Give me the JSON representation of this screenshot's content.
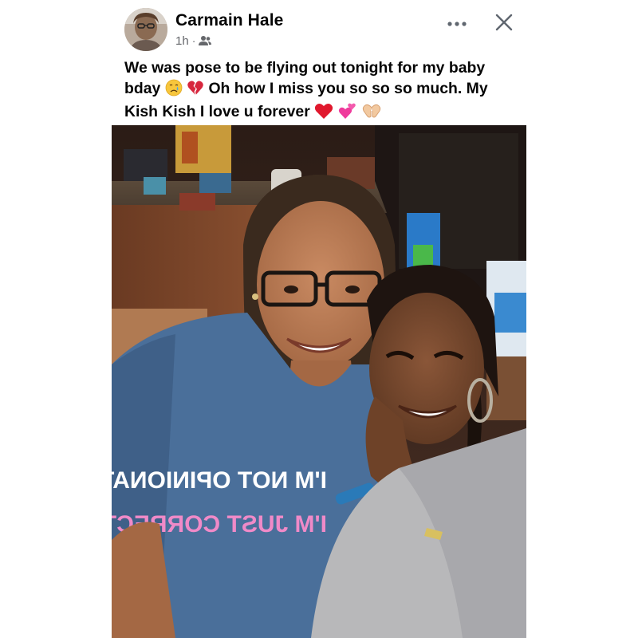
{
  "post": {
    "author": "Carmain Hale",
    "time": "1h",
    "separator": "·",
    "audience_icon": "friends-icon",
    "caption": {
      "part1": "We was pose to be flying out tonight for my baby bday",
      "part2": "Oh how I miss you so so so much. My Kish Kish I love u forever"
    },
    "photo": {
      "shirt_line1": "I'M NOT OPINIONATED..",
      "shirt_line2": "I'M JUST CORRECT."
    }
  },
  "icons": {
    "more": "more-horizontal-icon",
    "close": "close-icon",
    "emojis": [
      "crying-face-emoji",
      "broken-heart-emoji",
      "red-heart-emoji",
      "two-hearts-emoji",
      "heart-hands-emoji"
    ]
  },
  "colors": {
    "text_primary": "#050505",
    "text_secondary": "#65676b",
    "background": "#ffffff"
  }
}
